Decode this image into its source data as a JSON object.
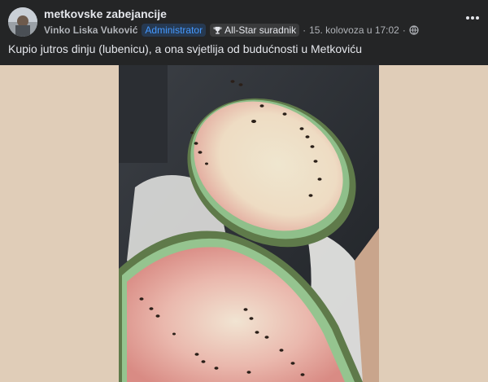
{
  "post": {
    "group_name": "metkovske zabejancije",
    "author": "Vinko Liska Vuković",
    "admin_badge": "Administrator",
    "star_badge": "All-Star suradnik",
    "separator": "·",
    "timestamp": "15. kolovoza u 17:02",
    "separator2": "·",
    "text": "Kupio jutros dinju (lubenicu), a ona svjetlija od budućnosti u Metkoviću"
  },
  "icons": {
    "privacy": "globe-icon",
    "badge": "trophy-icon",
    "more": "more-options-icon"
  },
  "colors": {
    "background": "#242526",
    "text": "#e4e6eb",
    "secondary_text": "#b0b3b8",
    "admin_badge_text": "#4599ff",
    "media_backdrop": "#e0cdb8"
  }
}
